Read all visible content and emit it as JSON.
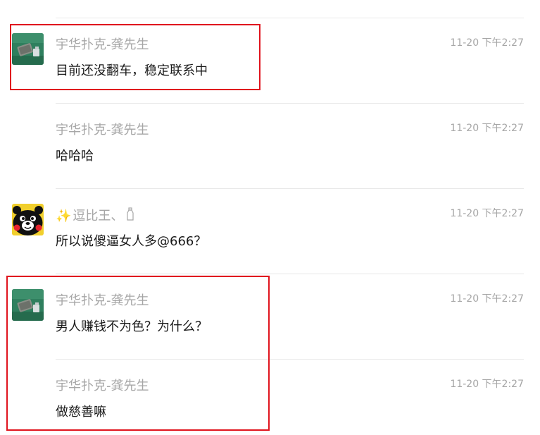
{
  "messages": [
    {
      "sender": "宇华扑克-龚先生",
      "text": "目前还没翻车，稳定联系中",
      "time": "11-20 下午2:27",
      "avatar_icon": "card-photo-avatar"
    },
    {
      "sender": "宇华扑克-龚先生",
      "text": "哈哈哈",
      "time": "11-20 下午2:27"
    },
    {
      "sender_prefix_icon": "sparkles-icon",
      "sender": "逗比王、",
      "sender_suffix_icon": "bottle-icon",
      "text": "所以说傻逼女人多@666？",
      "time": "11-20 下午2:27",
      "avatar_icon": "kumamon-avatar"
    },
    {
      "sender": "宇华扑克-龚先生",
      "text": "男人赚钱不为色？为什么？",
      "time": "11-20 下午2:27",
      "avatar_icon": "card-photo-avatar"
    },
    {
      "sender": "宇华扑克-龚先生",
      "text": "做慈善嘛",
      "time": "11-20 下午2:27"
    }
  ],
  "colors": {
    "highlight": "#e0141e",
    "sender": "#a6a6a6",
    "text": "#1a1a1a",
    "divider": "#e8e8e8"
  }
}
